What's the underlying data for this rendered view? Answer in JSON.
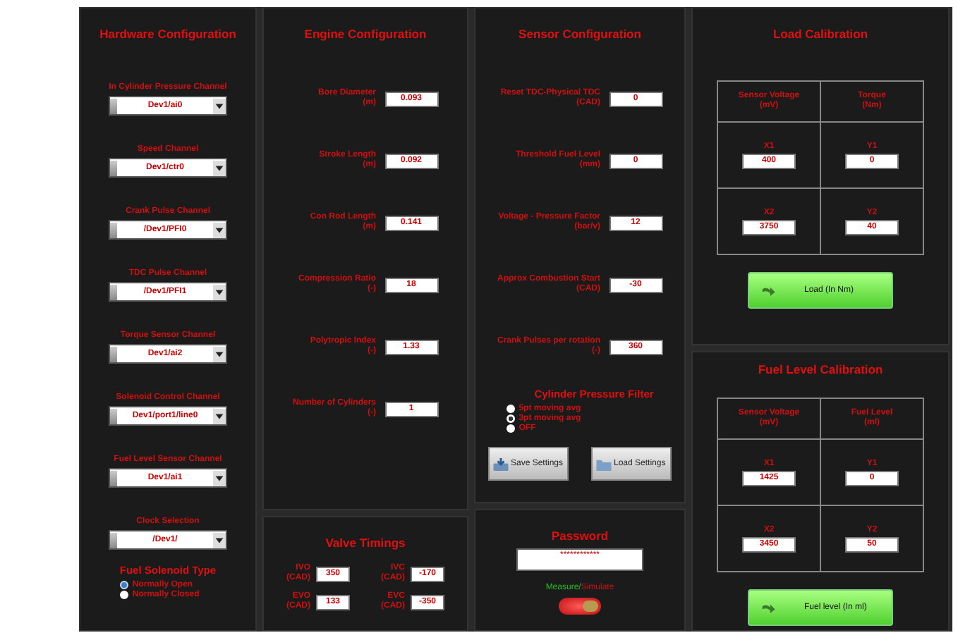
{
  "hardware": {
    "title": "Hardware Configuration",
    "channels": [
      {
        "label": "In Cylinder Pressure Channel",
        "value": "Dev1/ai0"
      },
      {
        "label": "Speed Channel",
        "value": "Dev1/ctr0"
      },
      {
        "label": "Crank Pulse Channel",
        "value": "/Dev1/PFI0"
      },
      {
        "label": "TDC Pulse Channel",
        "value": "/Dev1/PFI1"
      },
      {
        "label": "Torque Sensor Channel",
        "value": "Dev1/ai2"
      },
      {
        "label": "Solenoid Control Channel",
        "value": "Dev1/port1/line0"
      },
      {
        "label": "Fuel Level Sensor Channel",
        "value": "Dev1/ai1"
      },
      {
        "label": "Clock Selection",
        "value": "/Dev1/"
      }
    ],
    "solenoid": {
      "title": "Fuel Solenoid Type",
      "options": [
        {
          "label": "Normally Open",
          "selected": true
        },
        {
          "label": "Normally Closed",
          "selected": false
        }
      ]
    }
  },
  "engine": {
    "title": "Engine Configuration",
    "fields": [
      {
        "label": "Bore Diameter",
        "unit": "(m)",
        "value": "0.093"
      },
      {
        "label": "Stroke Length",
        "unit": "(m)",
        "value": "0.092"
      },
      {
        "label": "Con Rod Length",
        "unit": "(m)",
        "value": "0.141"
      },
      {
        "label": "Compression Ratio",
        "unit": "(-)",
        "value": "18"
      },
      {
        "label": "Polytropic Index",
        "unit": "(-)",
        "value": "1.33"
      },
      {
        "label": "Number of Cylinders",
        "unit": "(-)",
        "value": "1"
      }
    ]
  },
  "valve_timings": {
    "title": "Valve Timings",
    "fields": [
      {
        "label": "IVO",
        "unit": "(CAD)",
        "value": "350"
      },
      {
        "label": "IVC",
        "unit": "(CAD)",
        "value": "-170"
      },
      {
        "label": "EVO",
        "unit": "(CAD)",
        "value": "133"
      },
      {
        "label": "EVC",
        "unit": "(CAD)",
        "value": "-350"
      }
    ]
  },
  "sensor": {
    "title": "Sensor Configuration",
    "fields": [
      {
        "label": "Reset TDC-Physical TDC",
        "unit": "(CAD)",
        "value": "0"
      },
      {
        "label": "Threshold Fuel Level",
        "unit": "(mm)",
        "value": "0"
      },
      {
        "label": "Voltage - Pressure Factor",
        "unit": "(bar/v)",
        "value": "12"
      },
      {
        "label": "Approx Combustion Start",
        "unit": "(CAD)",
        "value": "-30"
      },
      {
        "label": "Crank Pulses per rotation",
        "unit": "(-)",
        "value": "360"
      }
    ],
    "filter": {
      "title": "Cylinder Pressure Filter",
      "options": [
        {
          "label": "5pt moving avg",
          "selected": false
        },
        {
          "label": "3pt moving avg",
          "selected": true
        },
        {
          "label": "OFF",
          "selected": false
        }
      ]
    },
    "buttons": [
      {
        "label": "Save Settings",
        "kind": "save"
      },
      {
        "label": "Load Settings",
        "kind": "load"
      }
    ]
  },
  "password": {
    "title": "Password",
    "value": "************",
    "mode_label": "Measure/",
    "mode_label_2": "Simulate",
    "simulate": true
  },
  "calibrations": [
    {
      "title": "Load Calibration",
      "headers": [
        {
          "label": "Sensor Voltage",
          "unit": "(mV)"
        },
        {
          "label": "Torque",
          "unit": "(Nm)"
        }
      ],
      "cells": [
        {
          "label": "X1",
          "value": "400"
        },
        {
          "label": "Y1",
          "value": "0"
        },
        {
          "label": "X2",
          "value": "3750"
        },
        {
          "label": "Y2",
          "value": "40"
        }
      ],
      "button": "Load (In Nm)"
    },
    {
      "title": "Fuel Level Calibration",
      "headers": [
        {
          "label": "Sensor Voltage",
          "unit": "(mV)"
        },
        {
          "label": "Fuel Level",
          "unit": "(ml)"
        }
      ],
      "cells": [
        {
          "label": "X1",
          "value": "1425"
        },
        {
          "label": "Y1",
          "value": "0"
        },
        {
          "label": "X2",
          "value": "3450"
        },
        {
          "label": "Y2",
          "value": "50"
        }
      ],
      "button": "Fuel level (In ml)"
    }
  ]
}
